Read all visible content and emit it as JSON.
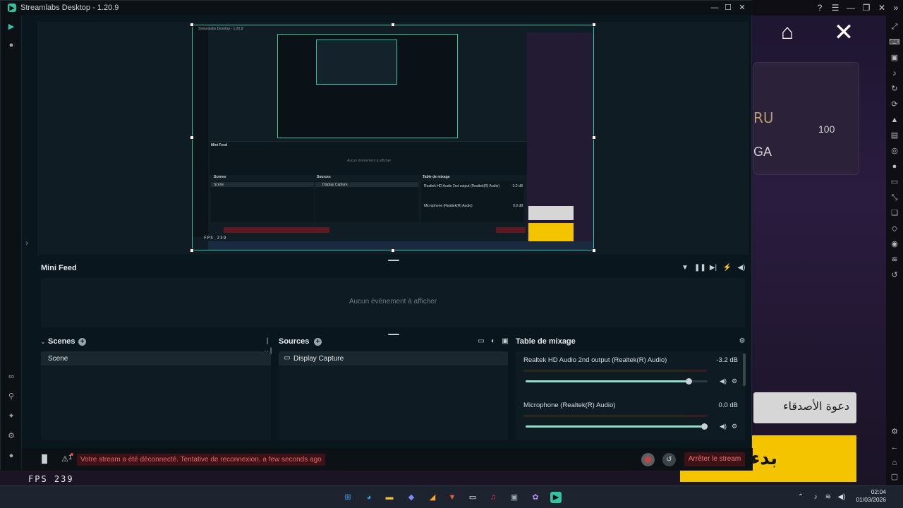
{
  "window": {
    "title": "Streamlabs Desktop - 1.20.9",
    "minimize": "—",
    "maximize": "☐",
    "close": "✕"
  },
  "preview": {
    "capture_title": "Streamlabs Desktop - 1.20.9",
    "inner_minifeed": "Mini Feed",
    "inner_empty": "Aucun événement à afficher",
    "inner_scenes": "Scenes",
    "inner_sources": "Sources",
    "inner_mixer": "Table de mixage",
    "inner_scene_item": "Scene",
    "inner_source_item": "Display Capture",
    "inner_audio1": "Realtek HD Audio 2nd output (Realtek(R) Audio)",
    "inner_audio2": "Microphone (Realtek(R) Audio)",
    "inner_db1": "-3.2 dB",
    "inner_db2": "0.0 dB",
    "inner_fps": "FPS 239"
  },
  "minifeed": {
    "title": "Mini Feed",
    "empty": "Aucun événement à afficher"
  },
  "scenes": {
    "title": "Scenes",
    "items": [
      "Scene"
    ]
  },
  "sources": {
    "title": "Sources",
    "items": [
      "Display Capture"
    ]
  },
  "mixer": {
    "title": "Table de mixage",
    "channels": [
      {
        "name": "Realtek HD Audio 2nd output (Realtek(R) Audio)",
        "db": "-3.2 dB",
        "level": 0.91
      },
      {
        "name": "Microphone (Realtek(R) Audio)",
        "db": "0.0 dB",
        "level": 1.0
      }
    ]
  },
  "footer": {
    "status_message": "Votre stream a été déconnecté. Tentative de reconnexion. a few seconds ago",
    "alert_count": "1",
    "stop_stream": "Arrêter le stream"
  },
  "game": {
    "ru": "RU",
    "count": "100",
    "ga": "GA",
    "invite": "دعوة الأصدقاء",
    "start": "بدء",
    "fps": "FPS 239"
  },
  "taskbar": {
    "time": "02:04",
    "date": "01/03/2026"
  },
  "colors": {
    "accent": "#31c3a2",
    "error_bg": "#3d1217",
    "error_text": "#e36a6a"
  }
}
